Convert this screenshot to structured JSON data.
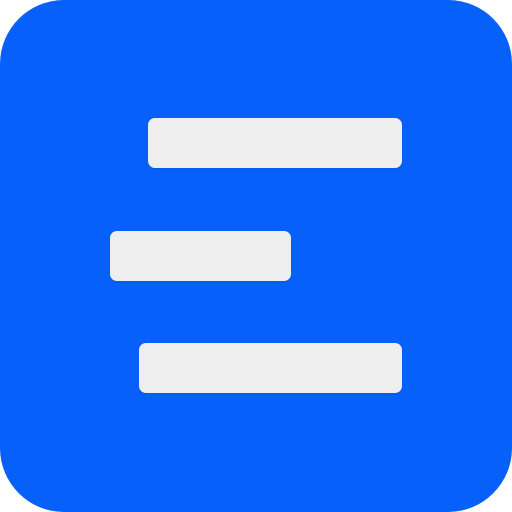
{
  "icon": {
    "name": "left-aligned-lines-app-icon",
    "background_color": "#0760FA",
    "bar_color": "#EEEEEE",
    "bars": [
      "top",
      "middle",
      "bottom"
    ]
  }
}
